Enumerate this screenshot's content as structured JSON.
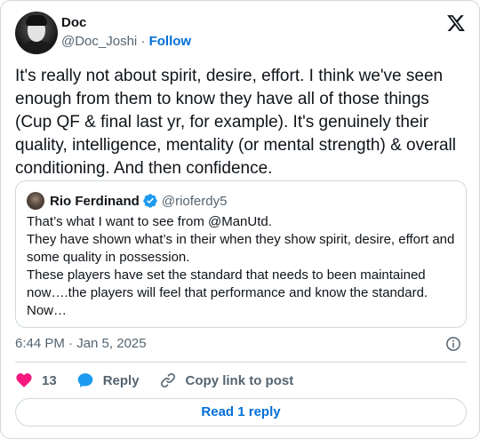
{
  "author": {
    "display_name": "Doc",
    "handle": "@Doc_Joshi",
    "separator": "·",
    "follow_label": "Follow"
  },
  "tweet": {
    "text": "It's really not about spirit, desire, effort. I think we've seen enough from them to know they have all of those things (Cup QF & final last yr, for example). It's genuinely their quality, intelligence, mentality (or mental strength) & overall conditioning. And then confidence.",
    "timestamp": "6:44 PM · Jan 5, 2025"
  },
  "quoted": {
    "display_name": "Rio Ferdinand",
    "handle": "@rioferdy5",
    "text": "That’s what I want to see from @ManUtd.\nThey have shown what’s in their when they show spirit, desire, effort and some quality in possession.\nThese players have set the standard that needs to been maintained now….the players will feel that performance and know the standard.\nNow…"
  },
  "actions": {
    "like_count": "13",
    "reply_label": "Reply",
    "copy_label": "Copy link to post"
  },
  "footer": {
    "read_reply_label": "Read 1 reply"
  },
  "colors": {
    "accent": "#006fd6",
    "like": "#f91880",
    "reply": "#1d9bf0",
    "muted": "#536471",
    "text": "#0f1419",
    "border": "#cfd9de"
  },
  "icons": {
    "brand": "x-logo-icon",
    "verified": "verified-badge-icon",
    "info": "info-icon",
    "like": "heart-icon",
    "reply": "speech-bubble-icon",
    "copy": "link-icon"
  }
}
